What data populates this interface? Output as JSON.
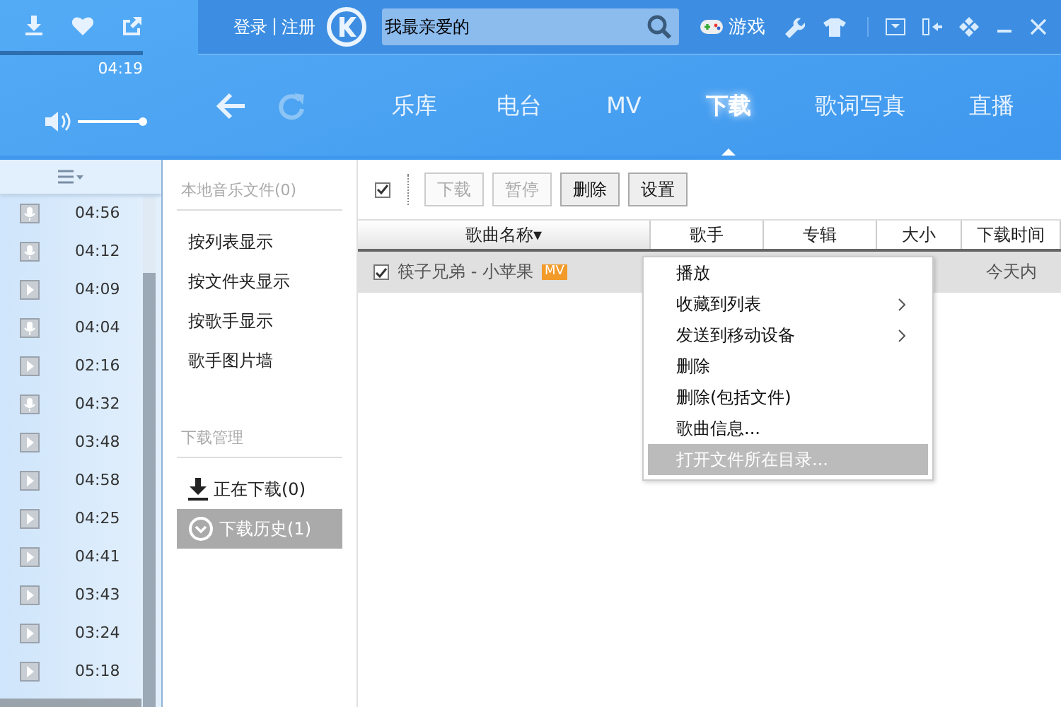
{
  "player": {
    "time": "04:19",
    "progress": {
      "level": 1
    },
    "volume": {
      "level": 1
    }
  },
  "account": {
    "login": "登录",
    "separator": "|",
    "register": "注册"
  },
  "search": {
    "value": "我最亲爱的"
  },
  "games": {
    "label": "游戏"
  },
  "nav_tabs": [
    {
      "label": "乐库",
      "selected": false
    },
    {
      "label": "电台",
      "selected": false
    },
    {
      "label": "MV",
      "selected": false
    },
    {
      "label": "下载",
      "selected": true
    },
    {
      "label": "歌词写真",
      "selected": false
    },
    {
      "label": "直播",
      "selected": false
    }
  ],
  "playlist": [
    {
      "kind": "mic",
      "duration": "04:56"
    },
    {
      "kind": "mic",
      "duration": "04:12"
    },
    {
      "kind": "video",
      "duration": "04:09"
    },
    {
      "kind": "mic",
      "duration": "04:04"
    },
    {
      "kind": "video",
      "duration": "02:16"
    },
    {
      "kind": "mic",
      "duration": "04:32"
    },
    {
      "kind": "video",
      "duration": "03:48"
    },
    {
      "kind": "video",
      "duration": "04:58"
    },
    {
      "kind": "video",
      "duration": "04:25"
    },
    {
      "kind": "video",
      "duration": "04:41"
    },
    {
      "kind": "video",
      "duration": "03:43"
    },
    {
      "kind": "video",
      "duration": "03:24"
    },
    {
      "kind": "video",
      "duration": "05:18"
    }
  ],
  "sidebar": {
    "sections": [
      {
        "title": "本地音乐文件(0)",
        "items": [
          {
            "label": "按列表显示",
            "kind": "plain",
            "selected": false
          },
          {
            "label": "按文件夹显示",
            "kind": "plain",
            "selected": false
          },
          {
            "label": "按歌手显示",
            "kind": "plain",
            "selected": false
          },
          {
            "label": "歌手图片墙",
            "kind": "plain",
            "selected": false
          }
        ]
      },
      {
        "title": "下载管理",
        "items": [
          {
            "label": "正在下载(0)",
            "kind": "download",
            "selected": false
          },
          {
            "label": "下载历史(1)",
            "kind": "history",
            "selected": true
          }
        ]
      }
    ]
  },
  "toolbar": {
    "select_all": {
      "checked": true
    },
    "buttons": [
      {
        "label": "下载",
        "disabled": true
      },
      {
        "label": "暂停",
        "disabled": true
      },
      {
        "label": "删除",
        "disabled": false
      },
      {
        "label": "设置",
        "disabled": false
      }
    ]
  },
  "table": {
    "columns": [
      "歌曲名称▾",
      "歌手",
      "专辑",
      "大小",
      "下载时间"
    ],
    "rows": [
      {
        "checked": true,
        "title": "筷子兄弟 - 小苹果",
        "badge": "MV",
        "download_time": "今天内"
      }
    ]
  },
  "context_menu": [
    {
      "label": "播放",
      "submenu": false,
      "selected": false
    },
    {
      "label": "收藏到列表",
      "submenu": true,
      "selected": false
    },
    {
      "label": "发送到移动设备",
      "submenu": true,
      "selected": false
    },
    {
      "label": "删除",
      "submenu": false,
      "selected": false
    },
    {
      "label": "删除(包括文件)",
      "submenu": false,
      "selected": false
    },
    {
      "label": "歌曲信息...",
      "submenu": false,
      "selected": false
    },
    {
      "label": "打开文件所在目录...",
      "submenu": false,
      "selected": true
    }
  ]
}
